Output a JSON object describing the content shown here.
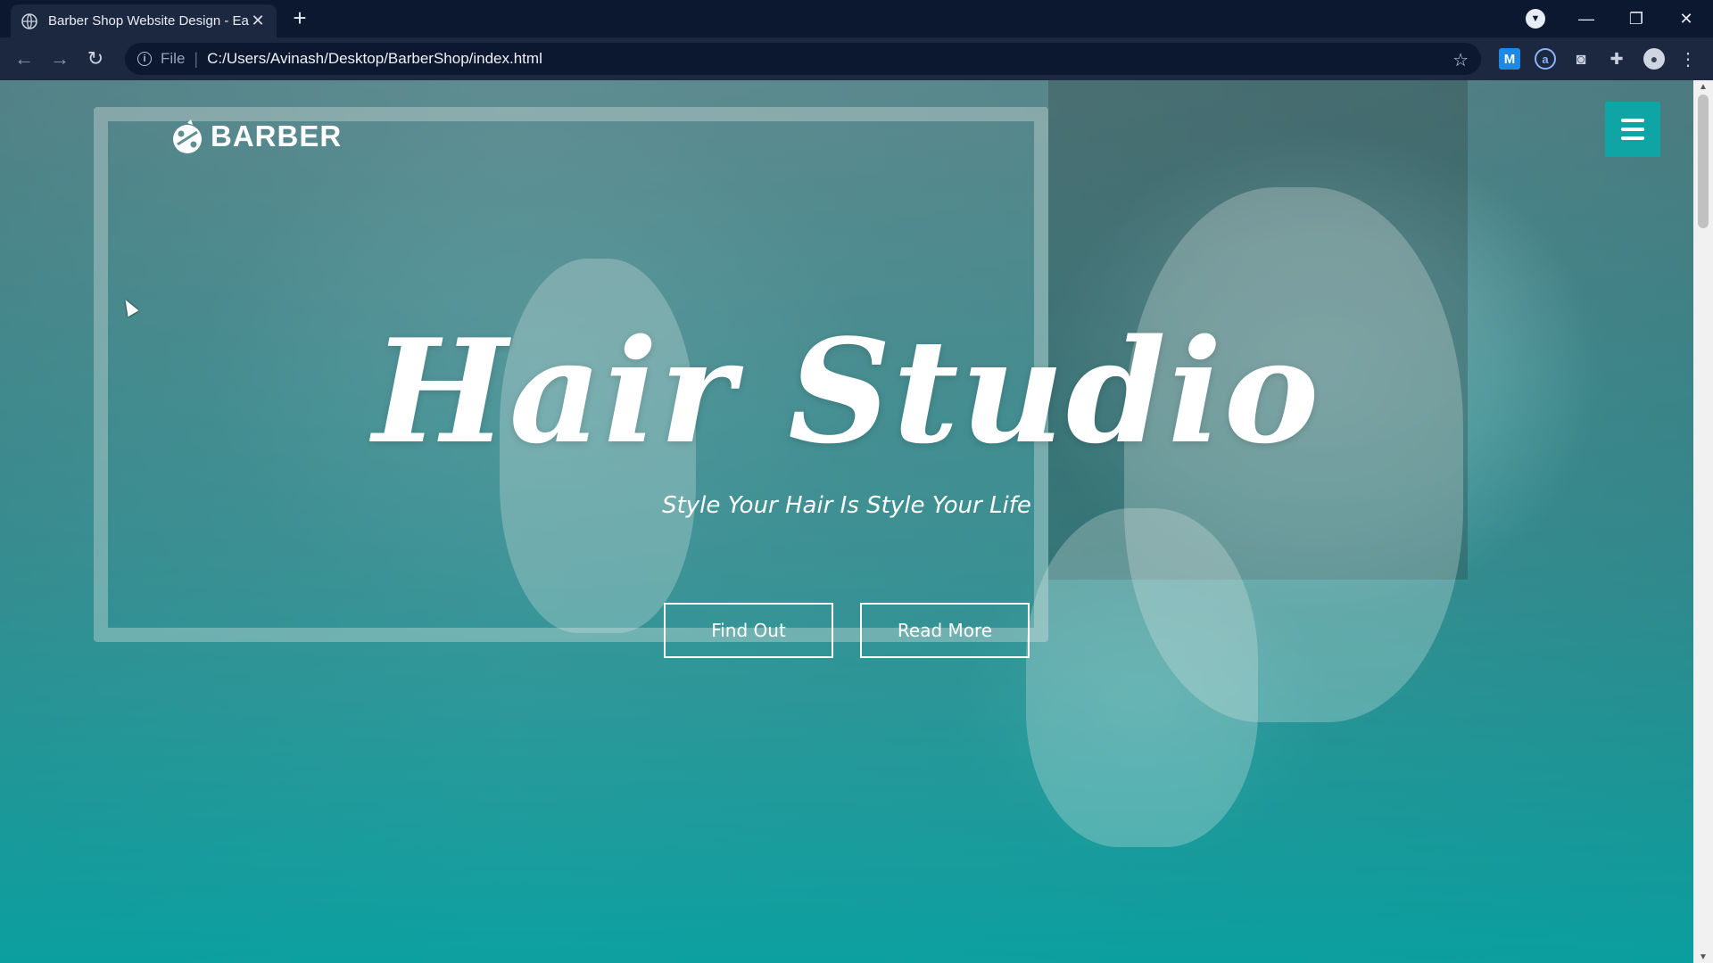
{
  "browser": {
    "tab_title": "Barber Shop Website Design - Ea",
    "tab_close": "✕",
    "new_tab": "+",
    "scheme": "File",
    "url": "C:/Users/Avinash/Desktop/BarberShop/index.html",
    "icons": [
      "globe-icon",
      "back-icon",
      "forward-icon",
      "reload-icon",
      "info-icon",
      "star-icon",
      "extension-m-icon",
      "extension-a-icon",
      "camera-icon",
      "puzzle-icon",
      "profile-avatar-icon",
      "menu-dots-icon",
      "minimize-icon",
      "restore-icon",
      "close-icon"
    ]
  },
  "page": {
    "logo_text": "BARBER",
    "hero_title": "Hair Studio",
    "hero_subtitle": "Style Your Hair Is Style Your Life",
    "buttons": {
      "find_out": "Find Out",
      "read_more": "Read More"
    },
    "colors": {
      "accent": "#0fa5a5",
      "overlay": "#06a0a0",
      "chrome_dark": "#0c1730",
      "chrome_toolbar": "#1c2740"
    }
  }
}
